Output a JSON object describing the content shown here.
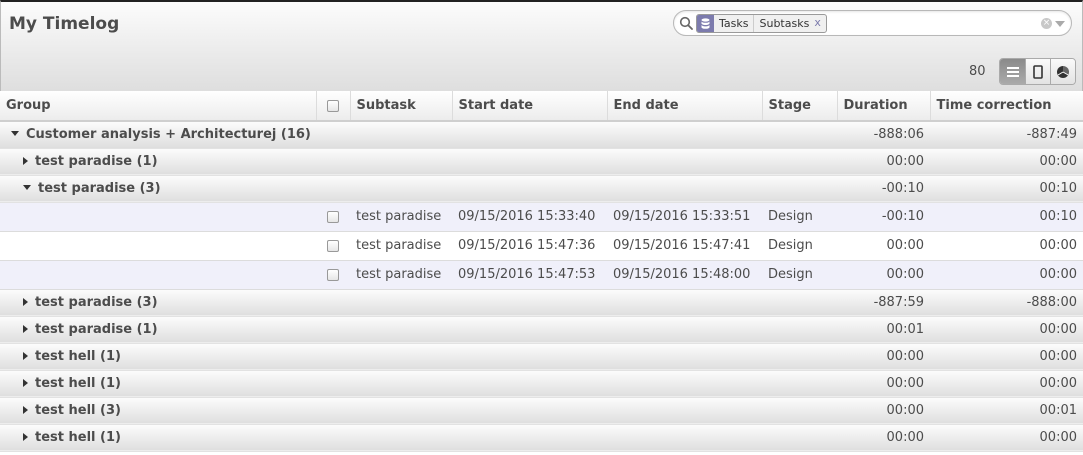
{
  "page": {
    "title": "My Timelog"
  },
  "search": {
    "facet_values": [
      "Tasks",
      "Subtasks"
    ],
    "facet_close": "x",
    "clear": "×"
  },
  "pager": {
    "count": "80"
  },
  "columns": [
    "Group",
    "Subtask",
    "Start date",
    "End date",
    "Stage",
    "Duration",
    "Time correction"
  ],
  "rows": [
    {
      "kind": "group",
      "level": 1,
      "open": true,
      "label": "Customer analysis + Architecturej (16)",
      "duration": "-888:06",
      "correction": "-887:49"
    },
    {
      "kind": "group",
      "level": 2,
      "open": false,
      "label": "test paradise (1)",
      "duration": "00:00",
      "correction": "00:00"
    },
    {
      "kind": "group",
      "level": 2,
      "open": true,
      "label": "test paradise (3)",
      "duration": "-00:10",
      "correction": "00:10"
    },
    {
      "kind": "record",
      "subtask": "test paradise",
      "start": "09/15/2016 15:33:40",
      "end": "09/15/2016 15:33:51",
      "stage": "Design",
      "duration": "-00:10",
      "correction": "00:10"
    },
    {
      "kind": "record",
      "subtask": "test paradise",
      "start": "09/15/2016 15:47:36",
      "end": "09/15/2016 15:47:41",
      "stage": "Design",
      "duration": "00:00",
      "correction": "00:00"
    },
    {
      "kind": "record",
      "subtask": "test paradise",
      "start": "09/15/2016 15:47:53",
      "end": "09/15/2016 15:48:00",
      "stage": "Design",
      "duration": "00:00",
      "correction": "00:00"
    },
    {
      "kind": "group",
      "level": 2,
      "open": false,
      "label": "test paradise (3)",
      "duration": "-887:59",
      "correction": "-888:00"
    },
    {
      "kind": "group",
      "level": 2,
      "open": false,
      "label": "test paradise (1)",
      "duration": "00:01",
      "correction": "00:00"
    },
    {
      "kind": "group",
      "level": 2,
      "open": false,
      "label": "test hell (1)",
      "duration": "00:00",
      "correction": "00:00"
    },
    {
      "kind": "group",
      "level": 2,
      "open": false,
      "label": "test hell (1)",
      "duration": "00:00",
      "correction": "00:00"
    },
    {
      "kind": "group",
      "level": 2,
      "open": false,
      "label": "test hell (3)",
      "duration": "00:00",
      "correction": "00:01"
    },
    {
      "kind": "group",
      "level": 2,
      "open": false,
      "label": "test hell (1)",
      "duration": "00:00",
      "correction": "00:00"
    }
  ]
}
